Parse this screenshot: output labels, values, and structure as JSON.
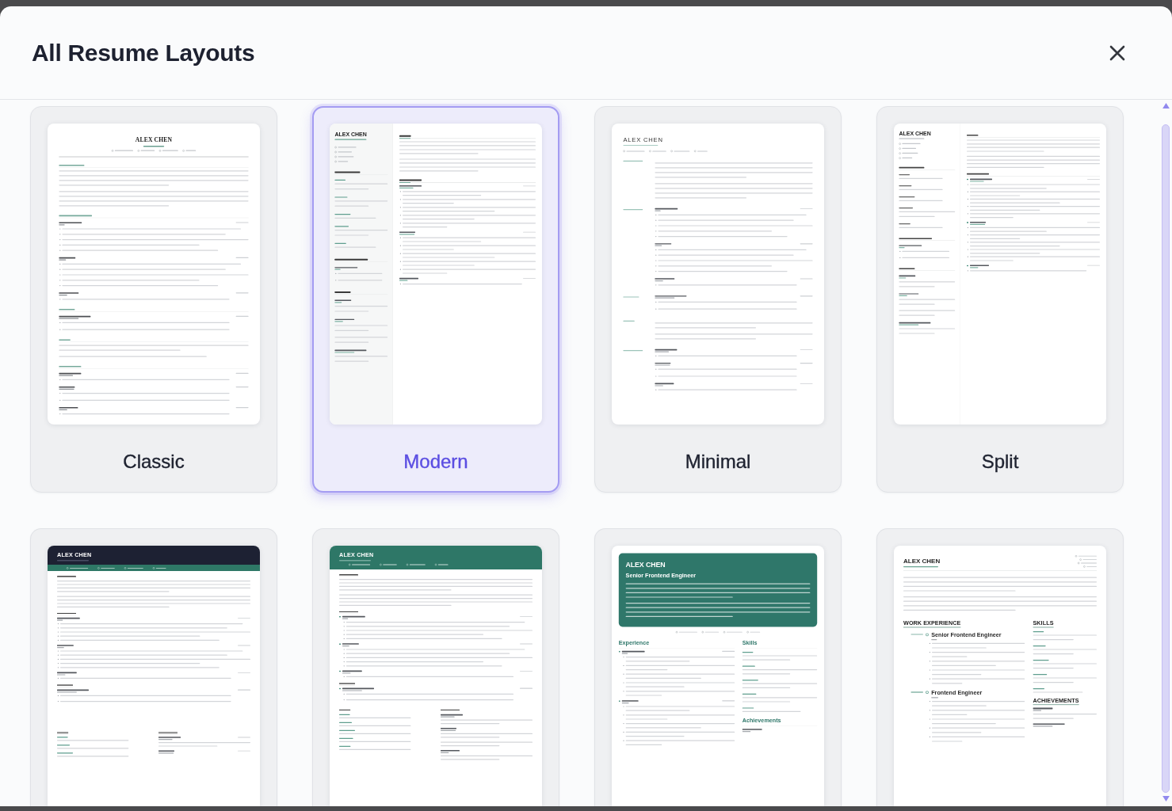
{
  "dialog": {
    "title": "All Resume Layouts"
  },
  "layouts": [
    {
      "label": "Classic",
      "selected": false,
      "kind": "classic",
      "name": "ALEX CHEN"
    },
    {
      "label": "Modern",
      "selected": true,
      "kind": "modern",
      "name": "ALEX CHEN"
    },
    {
      "label": "Minimal",
      "selected": false,
      "kind": "minimal",
      "name": "ALEX CHEN"
    },
    {
      "label": "Split",
      "selected": false,
      "kind": "split",
      "name": "ALEX CHEN"
    },
    {
      "selected": false,
      "kind": "bold",
      "name": "ALEX CHEN"
    },
    {
      "selected": false,
      "kind": "banner",
      "name": "ALEX CHEN"
    },
    {
      "selected": false,
      "kind": "card",
      "name": "ALEX CHEN",
      "role": "Senior Frontend Engineer",
      "headings": [
        "Experience",
        "Skills",
        "Achievements"
      ]
    },
    {
      "selected": false,
      "kind": "timeline",
      "name": "ALEX CHEN",
      "headings": [
        "WORK EXPERIENCE",
        "SKILLS",
        "ACHIEVEMENTS"
      ],
      "entries": [
        "Senior Frontend Engineer",
        "Frontend Engineer"
      ]
    }
  ]
}
